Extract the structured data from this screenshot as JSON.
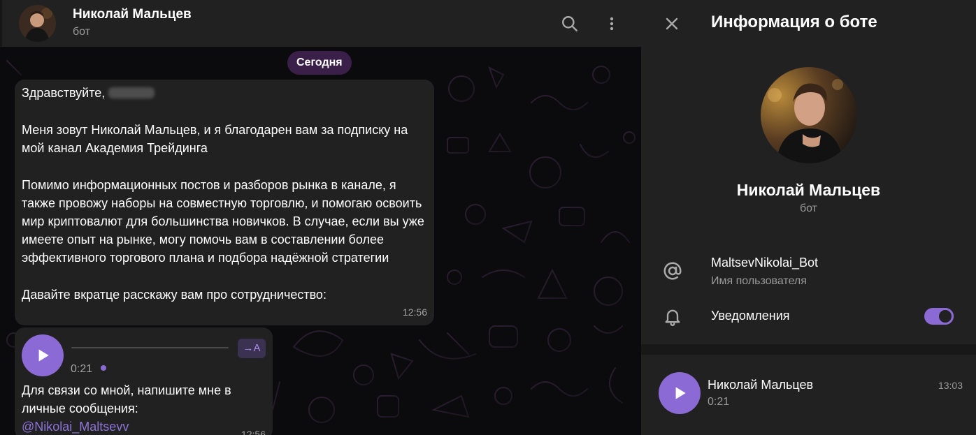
{
  "chat": {
    "header": {
      "name": "Николай Мальцев",
      "status": "бот",
      "search_icon": "search-icon",
      "more_icon": "more-vertical-icon"
    },
    "date_label": "Сегодня",
    "messages": [
      {
        "greeting": "Здравствуйте,",
        "paragraphs": [
          "Меня зовут Николай Мальцев, и я благодарен вам за подписку на мой канал Академия Трейдинга",
          "Помимо информационных постов и разборов рынка в канале, я также провожу наборы на совместную торговлю, и помогаю освоить мир криптовалют для большинства новичков. В случае, если вы уже имеете опыт на рынке, могу помочь вам в составлении более эффективного торгового плана и подбора надёжной стратегии",
          "Давайте вкратце расскажу вам про сотрудничество:"
        ],
        "time": "12:56"
      },
      {
        "voice_duration": "0:21",
        "transcribe_label": "→A",
        "text": "Для связи со мной, напишите мне в личные сообщения:",
        "mention": "@Nikolai_Maltsevv",
        "time": "12:56"
      }
    ]
  },
  "panel": {
    "title": "Информация о боте",
    "close_icon": "close-icon",
    "bot_name": "Николай Мальцев",
    "bot_sub": "бот",
    "username": "MaltsevNikolai_Bot",
    "username_label": "Имя пользователя",
    "notifications_label": "Уведомления",
    "notifications_on": true,
    "audio": {
      "title": "Николай Мальцев",
      "duration": "0:21",
      "time": "13:03"
    }
  },
  "colors": {
    "accent": "#8b6ad6",
    "panel_bg": "#212121",
    "bubble_bg": "#212121",
    "date_pill": "#3a1f49",
    "mention": "#8e74d8"
  }
}
